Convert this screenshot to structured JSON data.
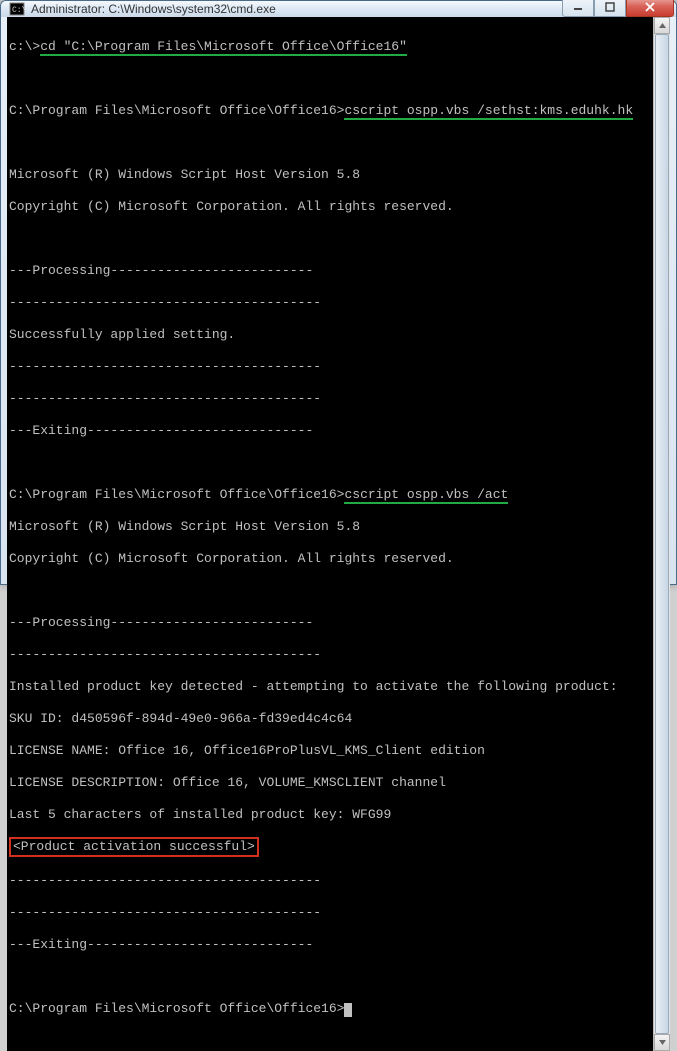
{
  "window": {
    "title": "Administrator: C:\\Windows\\system32\\cmd.exe"
  },
  "terminal": {
    "prompt1_prefix": "c:\\>",
    "prompt1_cmd": "cd \"C:\\Program Files\\Microsoft Office\\Office16\"",
    "prompt2_prefix": "C:\\Program Files\\Microsoft Office\\Office16>",
    "prompt2_cmd": "cscript ospp.vbs /sethst:kms.eduhk.hk",
    "ver_line": "Microsoft (R) Windows Script Host Version 5.8",
    "copy_line": "Copyright (C) Microsoft Corporation. All rights reserved.",
    "processing": "---Processing--------------------------",
    "dashes": "----------------------------------------",
    "applied": "Successfully applied setting.",
    "exiting": "---Exiting-----------------------------",
    "prompt3_prefix": "C:\\Program Files\\Microsoft Office\\Office16>",
    "prompt3_cmd": "cscript ospp.vbs /act",
    "detected": "Installed product key detected - attempting to activate the following product:",
    "sku": "SKU ID: d450596f-894d-49e0-966a-fd39ed4c4c64",
    "licname": "LICENSE NAME: Office 16, Office16ProPlusVL_KMS_Client edition",
    "licdesc": "LICENSE DESCRIPTION: Office 16, VOLUME_KMSCLIENT channel",
    "last5": "Last 5 characters of installed product key: WFG99",
    "activated": "<Product activation successful>",
    "prompt4_prefix": "C:\\Program Files\\Microsoft Office\\Office16>"
  }
}
